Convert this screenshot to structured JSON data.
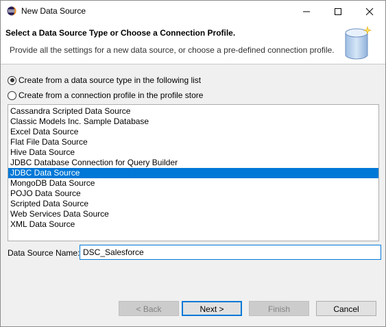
{
  "window": {
    "title": "New Data Source"
  },
  "banner": {
    "title": "Select a Data Source Type or Choose a Connection Profile.",
    "description": "Provide all the settings for a new data source, or choose a pre-defined connection profile."
  },
  "options": {
    "from_type_label": "Create from a data source type in the following list",
    "from_profile_label": "Create from a connection profile in the profile store",
    "selected": "from_type"
  },
  "list": {
    "items": [
      "Cassandra Scripted Data Source",
      "Classic Models Inc. Sample Database",
      "Excel Data Source",
      "Flat File Data Source",
      "Hive Data Source",
      "JDBC Database Connection for Query Builder",
      "JDBC Data Source",
      "MongoDB Data Source",
      "POJO Data Source",
      "Scripted Data Source",
      "Web Services Data Source",
      "XML Data Source"
    ],
    "selected_index": 6
  },
  "name_field": {
    "label": "Data Source Name:",
    "value": "DSC_Salesforce"
  },
  "buttons": {
    "back": "< Back",
    "next": "Next >",
    "finish": "Finish",
    "cancel": "Cancel"
  },
  "colors": {
    "selection": "#0078d7",
    "dialog_bg": "#f0f0f0"
  }
}
